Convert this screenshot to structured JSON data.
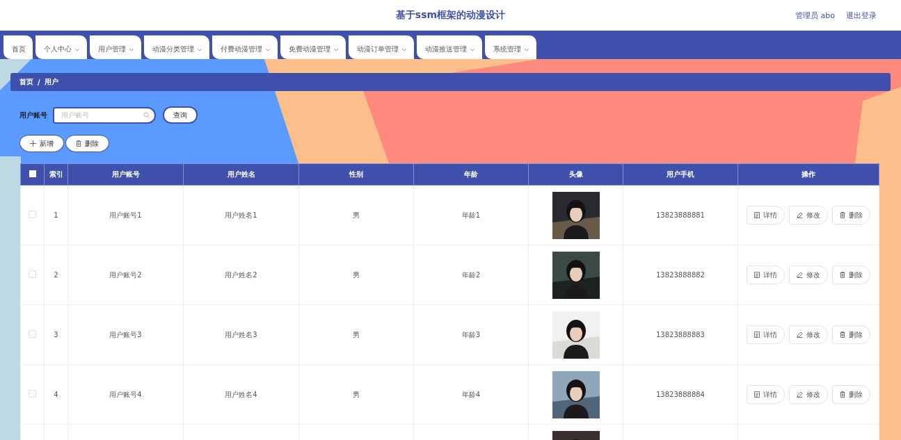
{
  "header": {
    "title": "基于ssm框架的动漫设计",
    "user": "管理员 abo",
    "logout": "退出登录"
  },
  "nav": [
    {
      "label": "首页",
      "dropdown": false
    },
    {
      "label": "个人中心",
      "dropdown": true
    },
    {
      "label": "用户管理",
      "dropdown": true
    },
    {
      "label": "动漫分类管理",
      "dropdown": true
    },
    {
      "label": "付费动漫管理",
      "dropdown": true
    },
    {
      "label": "免费动漫管理",
      "dropdown": true
    },
    {
      "label": "动漫订单管理",
      "dropdown": true
    },
    {
      "label": "动漫推送管理",
      "dropdown": true
    },
    {
      "label": "系统管理",
      "dropdown": true
    }
  ],
  "breadcrumb": [
    "首页",
    "/",
    "用户"
  ],
  "search": {
    "label": "用户账号",
    "placeholder": "用户账号",
    "button": "查询"
  },
  "actions": [
    {
      "kind": "add",
      "label": "新增"
    },
    {
      "kind": "delete",
      "label": "删除"
    }
  ],
  "table": {
    "select_all": {
      "checked": false
    },
    "columns": [
      "索引",
      "用户账号",
      "用户姓名",
      "性别",
      "年龄",
      "头像",
      "用户手机",
      "操作"
    ],
    "rows": [
      {
        "selected": false,
        "index": "1",
        "account": "用户账号1",
        "name": "用户姓名1",
        "gender": "男",
        "age": "年龄1",
        "avatar": {
          "kind": "picture"
        },
        "phone": "13823888881",
        "buttons": [
          {
            "kind": "detail",
            "label": "详情"
          },
          {
            "kind": "edit",
            "label": "修改"
          },
          {
            "kind": "delete",
            "label": "删除"
          }
        ]
      },
      {
        "selected": false,
        "index": "2",
        "account": "用户账号2",
        "name": "用户姓名2",
        "gender": "男",
        "age": "年龄2",
        "avatar": {
          "kind": "picture"
        },
        "phone": "13823888882",
        "buttons": [
          {
            "kind": "detail",
            "label": "详情"
          },
          {
            "kind": "edit",
            "label": "修改"
          },
          {
            "kind": "delete",
            "label": "删除"
          }
        ]
      },
      {
        "selected": false,
        "index": "3",
        "account": "用户账号3",
        "name": "用户姓名3",
        "gender": "男",
        "age": "年龄3",
        "avatar": {
          "kind": "picture"
        },
        "phone": "13823888883",
        "buttons": [
          {
            "kind": "detail",
            "label": "详情"
          },
          {
            "kind": "edit",
            "label": "修改"
          },
          {
            "kind": "delete",
            "label": "删除"
          }
        ]
      },
      {
        "selected": false,
        "index": "4",
        "account": "用户账号4",
        "name": "用户姓名4",
        "gender": "男",
        "age": "年龄4",
        "avatar": {
          "kind": "picture"
        },
        "phone": "13823888884",
        "buttons": [
          {
            "kind": "detail",
            "label": "详情"
          },
          {
            "kind": "edit",
            "label": "修改"
          },
          {
            "kind": "delete",
            "label": "删除"
          }
        ]
      },
      {
        "avatar": {
          "kind": "picture"
        }
      }
    ]
  }
}
